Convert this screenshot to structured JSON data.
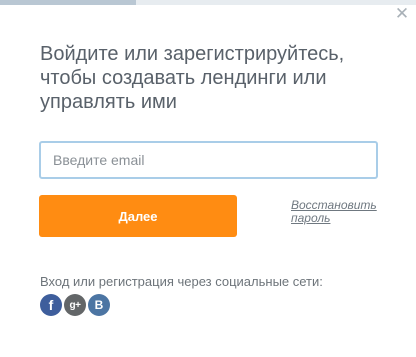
{
  "modal": {
    "close_icon": "close-icon",
    "heading": "Войдите или зарегистрируйтесь, чтобы создавать лендинги или управлять ими"
  },
  "form": {
    "email_placeholder": "Введите email",
    "email_value": "",
    "submit_label": "Далее",
    "restore_link": "Восстановить пароль"
  },
  "social": {
    "caption": "Вход или регистрация через социальные сети:",
    "buttons": [
      {
        "name": "facebook",
        "glyph": "f",
        "color": "#3e5e9c"
      },
      {
        "name": "google-plus",
        "glyph": "g+",
        "color": "#636668"
      },
      {
        "name": "vkontakte",
        "glyph": "B",
        "color": "#4c75a3"
      }
    ]
  },
  "colors": {
    "accent": "#ff8c12",
    "input_focus_border": "#a9cde8",
    "text": "#59616a"
  }
}
